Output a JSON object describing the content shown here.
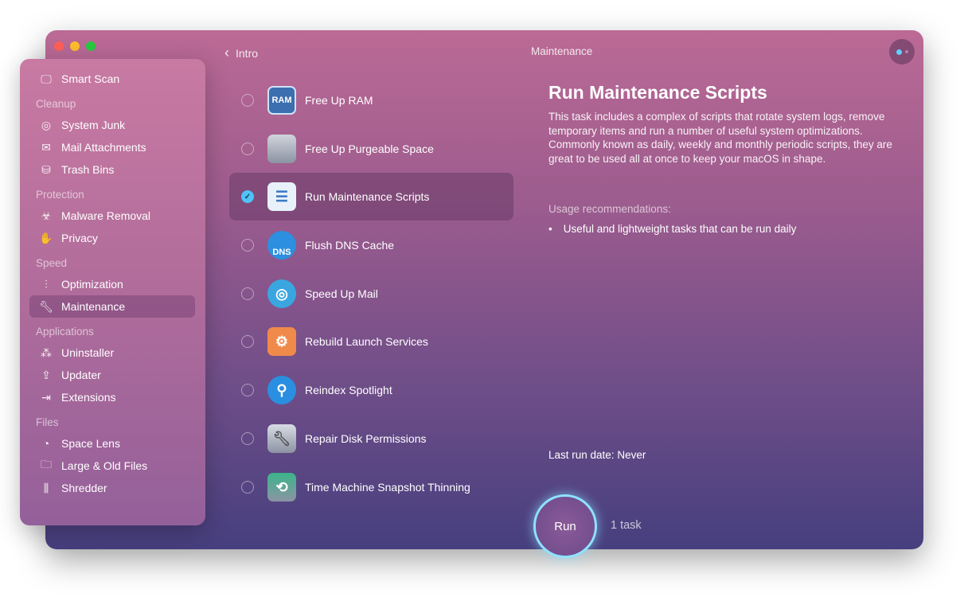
{
  "window": {
    "title": "Maintenance",
    "back_label": "Intro"
  },
  "sidebar": {
    "smart_scan": "Smart Scan",
    "sections": [
      {
        "header": "Cleanup",
        "items": [
          "System Junk",
          "Mail Attachments",
          "Trash Bins"
        ]
      },
      {
        "header": "Protection",
        "items": [
          "Malware Removal",
          "Privacy"
        ]
      },
      {
        "header": "Speed",
        "items": [
          "Optimization",
          "Maintenance"
        ]
      },
      {
        "header": "Applications",
        "items": [
          "Uninstaller",
          "Updater",
          "Extensions"
        ]
      },
      {
        "header": "Files",
        "items": [
          "Space Lens",
          "Large & Old Files",
          "Shredder"
        ]
      }
    ],
    "active": "Maintenance"
  },
  "tasks": [
    {
      "label": "Free Up RAM",
      "icon_text": "RAM",
      "checked": false
    },
    {
      "label": "Free Up Purgeable Space",
      "checked": false
    },
    {
      "label": "Run Maintenance Scripts",
      "checked": true
    },
    {
      "label": "Flush DNS Cache",
      "icon_text": "DNS",
      "checked": false
    },
    {
      "label": "Speed Up Mail",
      "checked": false
    },
    {
      "label": "Rebuild Launch Services",
      "checked": false
    },
    {
      "label": "Reindex Spotlight",
      "checked": false
    },
    {
      "label": "Repair Disk Permissions",
      "checked": false
    },
    {
      "label": "Time Machine Snapshot Thinning",
      "checked": false
    }
  ],
  "detail": {
    "title": "Run Maintenance Scripts",
    "description": "This task includes a complex of scripts that rotate system logs, remove temporary items and run a number of useful system optimizations. Commonly known as daily, weekly and monthly periodic scripts, they are great to be used all at once to keep your macOS in shape.",
    "usage_header": "Usage recommendations:",
    "usage_items": [
      "Useful and lightweight tasks that can be run daily"
    ],
    "last_run_label": "Last run date:",
    "last_run_value": "Never"
  },
  "footer": {
    "run_label": "Run",
    "count": "1 task"
  },
  "colors": {
    "accent": "#4fc3f7",
    "run_ring": "#8ee3ff"
  }
}
